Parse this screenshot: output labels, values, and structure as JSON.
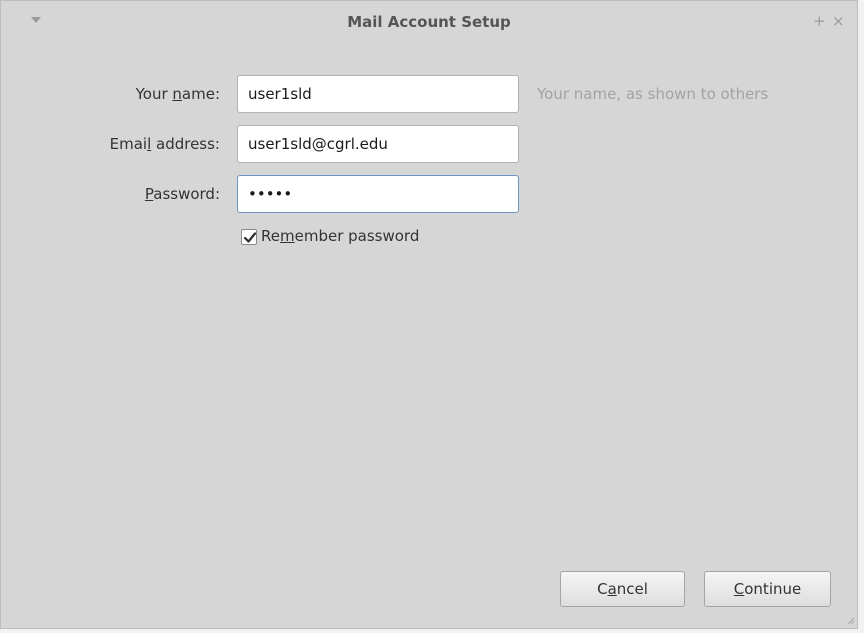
{
  "window": {
    "title": "Mail Account Setup",
    "menu_icon": "chevron-down-icon",
    "maximize_glyph": "+",
    "close_glyph": "×"
  },
  "form": {
    "name": {
      "label_before": "Your ",
      "label_mnemonic": "n",
      "label_after": "ame:",
      "value": "user1sld",
      "hint": "Your name, as shown to others"
    },
    "email": {
      "label_before": "Emai",
      "label_mnemonic": "l",
      "label_after": " address:",
      "value": "user1sld@cgrl.edu"
    },
    "password": {
      "label_before": "",
      "label_mnemonic": "P",
      "label_after": "assword:",
      "value": "•••••"
    },
    "remember": {
      "label_before": "Re",
      "label_mnemonic": "m",
      "label_after": "ember password",
      "checked": true
    }
  },
  "buttons": {
    "cancel": {
      "before": "C",
      "mnemonic": "a",
      "after": "ncel"
    },
    "continue": {
      "before": "",
      "mnemonic": "C",
      "after": "ontinue"
    }
  }
}
